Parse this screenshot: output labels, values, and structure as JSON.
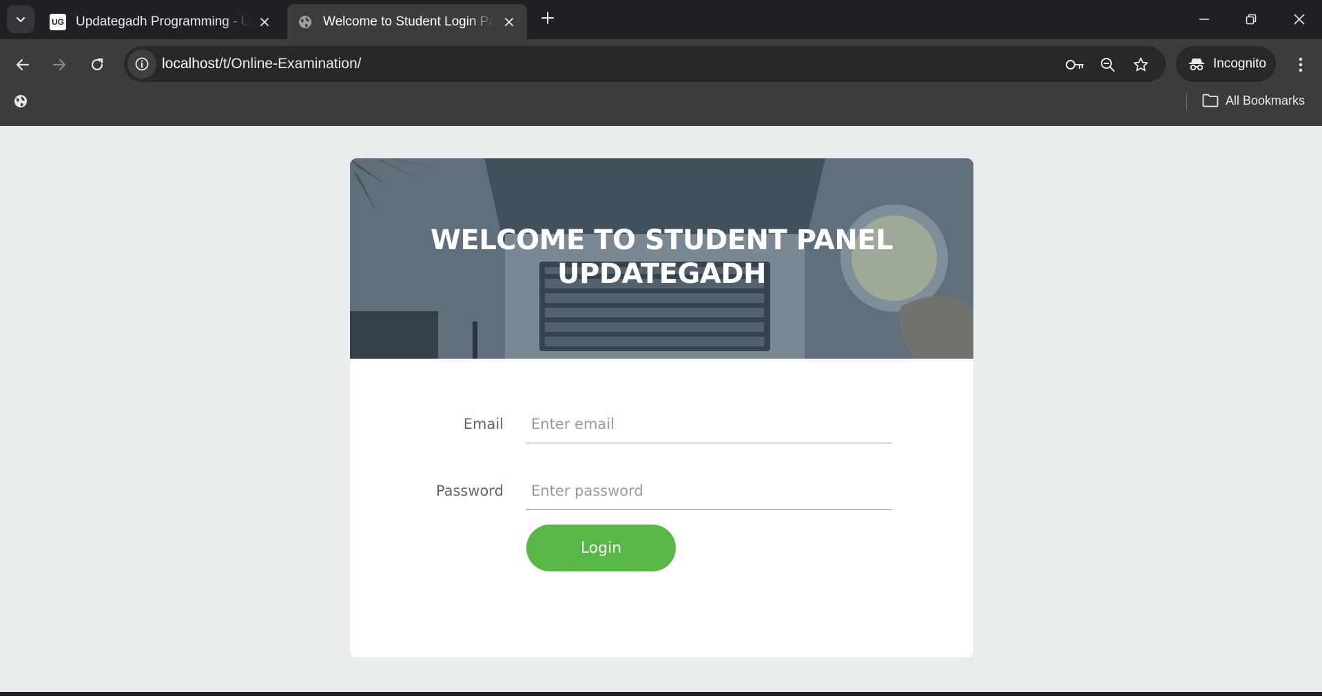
{
  "browser": {
    "tabs": [
      {
        "title": "Updategadh Programming - Updategadh",
        "favicon": "ug-logo-icon",
        "active": false
      },
      {
        "title": "Welcome to Student Login Panel",
        "favicon": "globe-icon",
        "active": true
      }
    ],
    "address": {
      "host": "localhost",
      "path": "/t/Online-Examination/"
    },
    "profile_label": "Incognito",
    "bookmarks_label": "All Bookmarks",
    "favicon_text": "UG"
  },
  "page": {
    "hero": {
      "title_line1": "WELCOME TO STUDENT PANEL",
      "title_line2": "UPDATEGADH"
    },
    "form": {
      "email_label": "Email",
      "email_placeholder": "Enter email",
      "password_label": "Password",
      "password_placeholder": "Enter password",
      "login_label": "Login"
    }
  },
  "colors": {
    "accent": "#57b846",
    "page_background": "#e9eded",
    "hero_overlay": "#5e6c78"
  }
}
